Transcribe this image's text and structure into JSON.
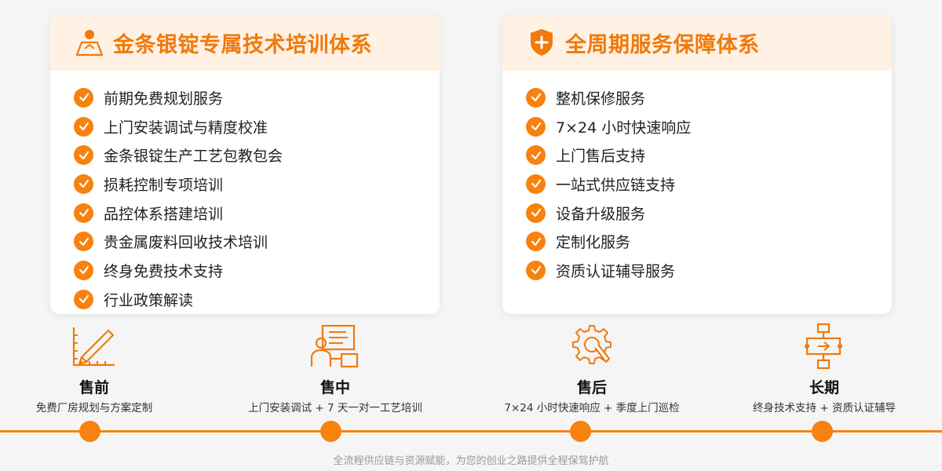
{
  "left_card": {
    "title": "金条银锭专属技术培训体系",
    "icon": "user-teacher-icon",
    "items": [
      "前期免费规划服务",
      "上门安装调试与精度校准",
      "金条银锭生产工艺包教包会",
      "损耗控制专项培训",
      "品控体系搭建培训",
      "贵金属废料回收技术培训",
      "终身免费技术支持",
      "行业政策解读"
    ]
  },
  "right_card": {
    "title": "全周期服务保障体系",
    "icon": "shield-plus-icon",
    "items": [
      "整机保修服务",
      "7×24 小时快速响应",
      "上门售后支持",
      "一站式供应链支持",
      "设备升级服务",
      "定制化服务",
      "资质认证辅导服务"
    ]
  },
  "stages": [
    {
      "title": "售前",
      "desc": "免费厂房规划与方案定制",
      "icon": "ruler-pencil-icon"
    },
    {
      "title": "售中",
      "desc": "上门安装调试 + 7 天一对一工艺培训",
      "icon": "trainer-board-icon"
    },
    {
      "title": "售后",
      "desc": "7×24 小时快速响应 + 季度上门巡检",
      "icon": "gear-wrench-icon"
    },
    {
      "title": "长期",
      "desc": "终身技术支持 + 资质认证辅导",
      "icon": "flow-cycle-icon"
    }
  ],
  "footer": "全流程供应链与资源赋能，为您的创业之路提供全程保驾护航",
  "colors": {
    "accent": "#f7820f",
    "title": "#f07a0c",
    "header_bg": "#fff1e4",
    "background": "#f5f5f5"
  }
}
